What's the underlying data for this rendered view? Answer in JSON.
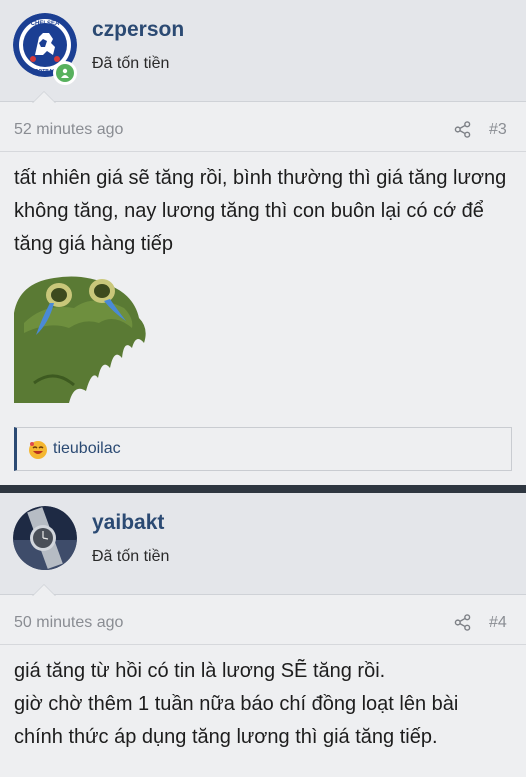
{
  "posts": [
    {
      "username": "czperson",
      "user_title": "Đã tốn tiền",
      "avatar": "chelsea-crest",
      "online": true,
      "time": "52 minutes ago",
      "post_number": "#3",
      "content": "tất nhiên giá sẽ tăng rồi, bình thường thì giá tăng lương không tăng, nay lương tăng thì con buôn lại có cớ để tăng giá hàng tiếp",
      "sticker": "crying-green-frog-sticker",
      "reaction_user": "tieuboilac",
      "reaction_icon": "laughing-emoji"
    },
    {
      "username": "yaibakt",
      "user_title": "Đã tốn tiền",
      "avatar": "watch-photo",
      "online": false,
      "time": "50 minutes ago",
      "post_number": "#4",
      "content_lines": [
        "giá tăng từ hồi có tin là lương SẼ tăng rồi.",
        "giờ chờ thêm 1 tuần nữa báo chí đồng loạt lên bài chính thức áp dụng tăng lương thì giá tăng tiếp."
      ]
    }
  ],
  "colors": {
    "username": "#2b4a73",
    "background": "#eeeff1",
    "header_bg": "#e4e6ea",
    "divider": "#2e3640",
    "online": "#58b15e"
  }
}
